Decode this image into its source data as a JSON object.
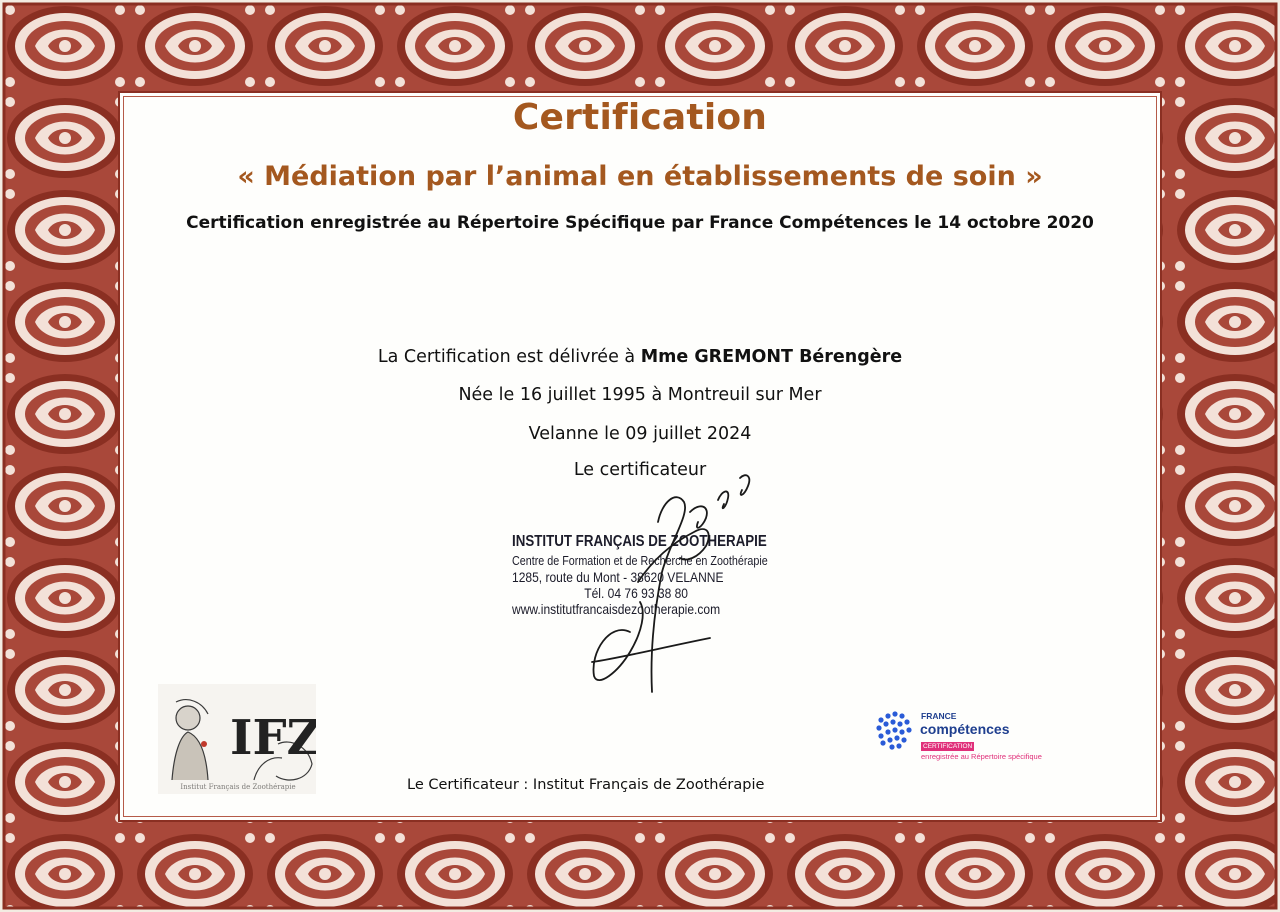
{
  "certificate": {
    "title": "Certification",
    "subtitle": "« Médiation par l’animal en établissements de soin »",
    "registration": "Certification enregistrée au Répertoire Spécifique par France Compétences le 14 octobre 2020",
    "delivered_prefix": "La Certification est délivrée à ",
    "recipient": "Mme GREMONT Bérengère",
    "birth": "Née le 16 juillet 1995 à Montreuil sur Mer",
    "place_date": "Velanne le 09 juillet 2024",
    "certifier_label": "Le certificateur",
    "footer": "Le Certificateur : Institut Français de Zoothérapie"
  },
  "stamp": {
    "name": "INSTITUT FRANÇAIS DE ZOOTHERAPIE",
    "subtitle": "Centre de Formation et de Recherche en Zoothérapie",
    "address": "1285, route du Mont - 38620 VELANNE",
    "phone": "Tél. 04 76 93 38 80",
    "website": "www.institutfrancaisdezootherapie.com"
  },
  "logos": {
    "ifz_text": "IFZ",
    "ifz_caption": "Institut Français de Zoothérapie",
    "fc_line1": "FRANCE",
    "fc_line2": "compétences",
    "fc_badge": "CERTIFICATION",
    "fc_line3": "enregistrée au Répertoire spécifique"
  },
  "colors": {
    "border_dark": "#8a2f22",
    "border_mid": "#a9483a",
    "border_light": "#f3e1d8",
    "title_color": "#a4581f",
    "fc_blue": "#1f3f8f",
    "fc_pink": "#e0307a"
  }
}
